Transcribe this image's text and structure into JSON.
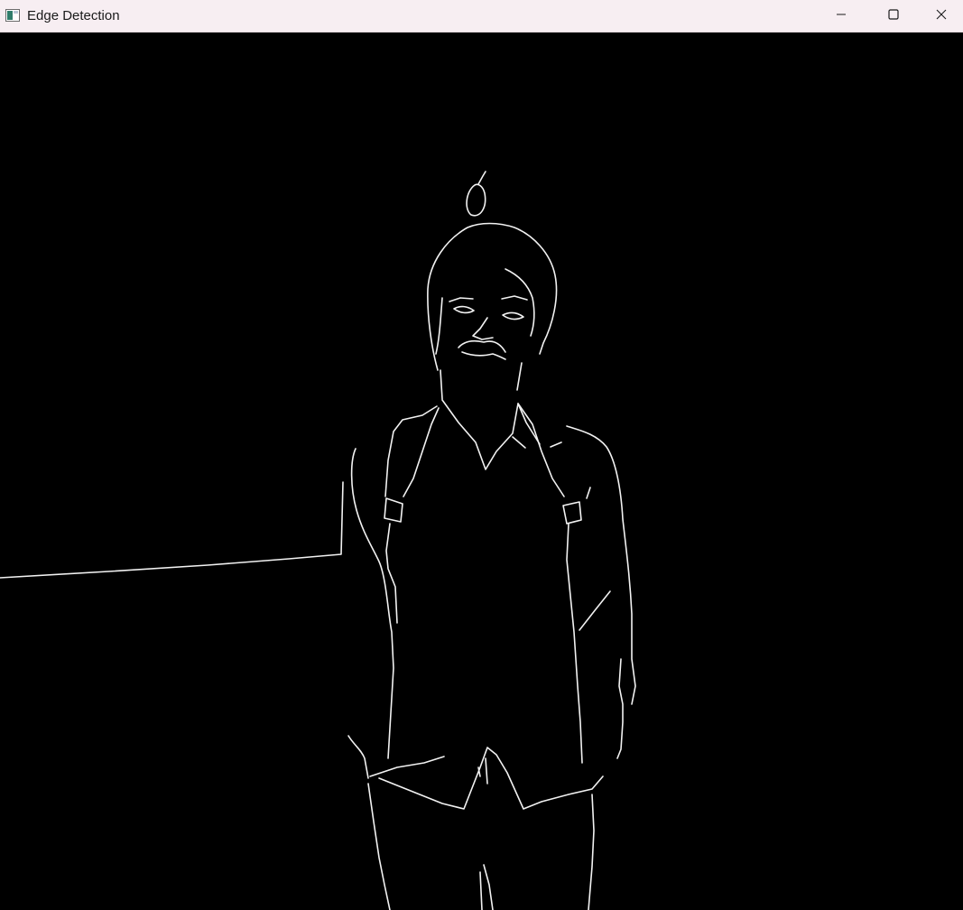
{
  "window": {
    "title": "Edge Detection",
    "icon": "app-window-icon",
    "controls": {
      "minimize_icon": "minimize-icon",
      "maximize_icon": "maximize-icon",
      "close_icon": "close-icon"
    }
  },
  "canvas": {
    "background": "#000000",
    "edge_color": "#f2f2f2"
  }
}
